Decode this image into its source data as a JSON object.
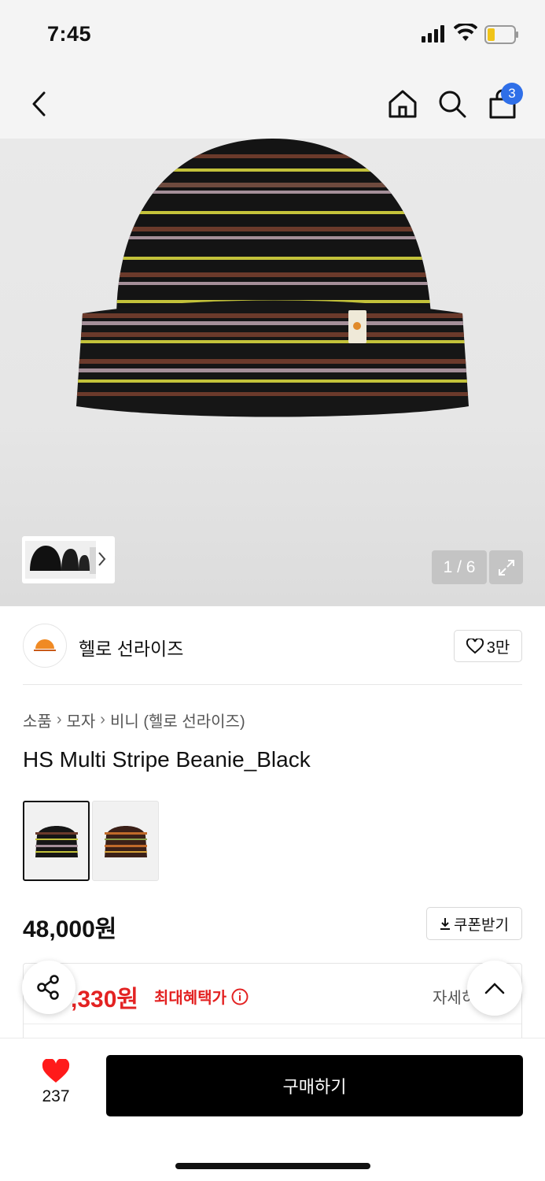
{
  "status_bar": {
    "time": "7:45"
  },
  "nav": {
    "back_icon": "chevron-left-icon",
    "home_icon": "home-icon",
    "search_icon": "search-icon",
    "cart_icon": "shopping-bag-icon",
    "cart_count": "3"
  },
  "gallery": {
    "counter": "1 / 6",
    "expand_icon": "expand-icon"
  },
  "brand": {
    "name": "헬로 선라이즈",
    "like_count": "3만"
  },
  "breadcrumb": [
    "소품",
    "모자",
    "비니 (헬로 선라이즈)"
  ],
  "product": {
    "title": "HS Multi Stripe Beanie_Black",
    "price": "48,000원",
    "coupon_label": "쿠폰받기",
    "benefit_price": ",330원",
    "benefit_label": "최대혜택가",
    "detail_link": "자세히"
  },
  "bottom": {
    "wish_count": "237",
    "buy_label": "구매하기"
  },
  "colors": {
    "accent_red": "#e32222",
    "badge_blue": "#2f6fe8",
    "buy_black": "#000000"
  }
}
